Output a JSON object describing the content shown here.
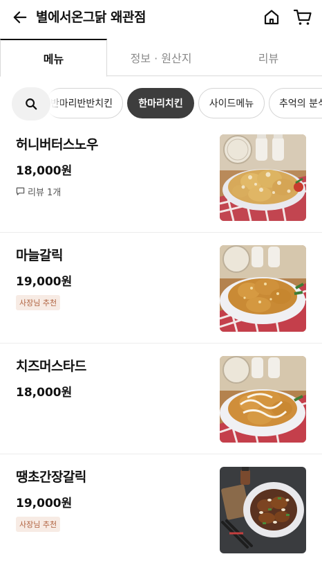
{
  "header": {
    "title": "별에서온그닭 왜관점",
    "back_icon": "arrow-left-icon",
    "home_icon": "home-icon",
    "cart_icon": "cart-icon"
  },
  "tabs": [
    {
      "label": "메뉴",
      "active": true
    },
    {
      "label": "정보 · 원산지",
      "active": false
    },
    {
      "label": "리뷰",
      "active": false
    }
  ],
  "categories": {
    "search_icon": "search-icon",
    "items": [
      {
        "label": "반마리반반치킨",
        "active": false
      },
      {
        "label": "한마리치킨",
        "active": true
      },
      {
        "label": "사이드메뉴",
        "active": false
      },
      {
        "label": "추억의 분식",
        "active": false
      }
    ]
  },
  "menu_items": [
    {
      "name": "허니버터스노우",
      "price": "18,000원",
      "review": "리뷰 1개",
      "badge": null,
      "photo": "honey-butter-snow-chicken-photo"
    },
    {
      "name": "마늘갈릭",
      "price": "19,000원",
      "review": null,
      "badge": "사장님 추천",
      "photo": "garlic-chicken-photo"
    },
    {
      "name": "치즈머스타드",
      "price": "18,000원",
      "review": null,
      "badge": null,
      "photo": "cheese-mustard-chicken-photo"
    },
    {
      "name": "땡초간장갈릭",
      "price": "19,000원",
      "review": null,
      "badge": "사장님 추천",
      "photo": "spicy-soy-garlic-chicken-photo"
    }
  ],
  "colors": {
    "active_chip_bg": "#3d3d3d",
    "badge_text": "#b0623f",
    "badge_bg": "#f7ebe4"
  }
}
